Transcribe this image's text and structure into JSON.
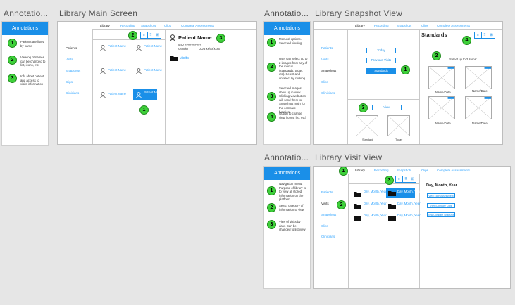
{
  "titles": {
    "annot1": "Annotatio...",
    "main": "Library Main Screen",
    "annot2": "Annotatio...",
    "snapshot": "Library Snapshot View",
    "annot3": "Annotatio...",
    "visit": "Library Visit View"
  },
  "annotations_header": "Annotations",
  "annot1_items": [
    {
      "num": "1",
      "text": "Patients are listed by name"
    },
    {
      "num": "2",
      "text": "Viewing of names can be changed to list, icons, etc."
    },
    {
      "num": "3",
      "text": "Info about patient and access to visits information"
    }
  ],
  "annot2_items": [
    {
      "num": "1",
      "text": "Menu of options. Selected viewing."
    },
    {
      "num": "2",
      "text": "User can select up to 2 images from any of the menus (standards, today, etc). Select and unselect by clicking."
    },
    {
      "num": "3",
      "text": "Selected images show up in view. Clicking view button will send them to Snapshots main for the compare function."
    },
    {
      "num": "4",
      "text": "Option to change view (icons, list, etc)"
    }
  ],
  "annot3_items": [
    {
      "num": "1",
      "text": "Navigation menu. Purpose of library is to view all stored information on the platform."
    },
    {
      "num": "2",
      "text": "Select category of information to view"
    },
    {
      "num": "3",
      "text": "View of visits by date. Can be changed to list view"
    }
  ],
  "top_nav": [
    "Library",
    "Recording",
    "Snapshots",
    "Clips",
    "Complete Assessments"
  ],
  "sidebar": [
    "Patients",
    "Visits",
    "Snapshots",
    "Clips",
    "Clinicians"
  ],
  "view_icons": [
    "≡",
    "⠿",
    "⊞"
  ],
  "main": {
    "patient_label": "Patient Name",
    "patient_name_heading": "Patient Name",
    "mid": "MID ##########",
    "gender": "Gender",
    "dob": "DOB xx/xx/xxxx",
    "visits": "Visits",
    "badges": {
      "a": "2",
      "b": "3",
      "c": "1"
    }
  },
  "snapshot": {
    "buttons": [
      "Today",
      "Previous Visits",
      "Standards"
    ],
    "view_button": "View",
    "standards_heading": "Standards",
    "select_hint": "Select up to 2 items:",
    "thumb_caption_a": "Name/Date",
    "thumb_caption_b": "Name/Date",
    "thumb_caption_c": "Name/Date",
    "thumb_caption_d": "Name/Date",
    "bottom_a": "Standard",
    "bottom_b": "Today",
    "badges": {
      "one": "1",
      "two": "2",
      "three": "3",
      "four": "4"
    }
  },
  "visit": {
    "folder_label": "Day, Month, Year",
    "heading": "Day, Month, Year",
    "buttons": [
      "View Each Assessment",
      "View/Compare Clips",
      "View/Compare Snapshots"
    ],
    "badges": {
      "one": "1",
      "two": "2",
      "three": "3"
    }
  }
}
